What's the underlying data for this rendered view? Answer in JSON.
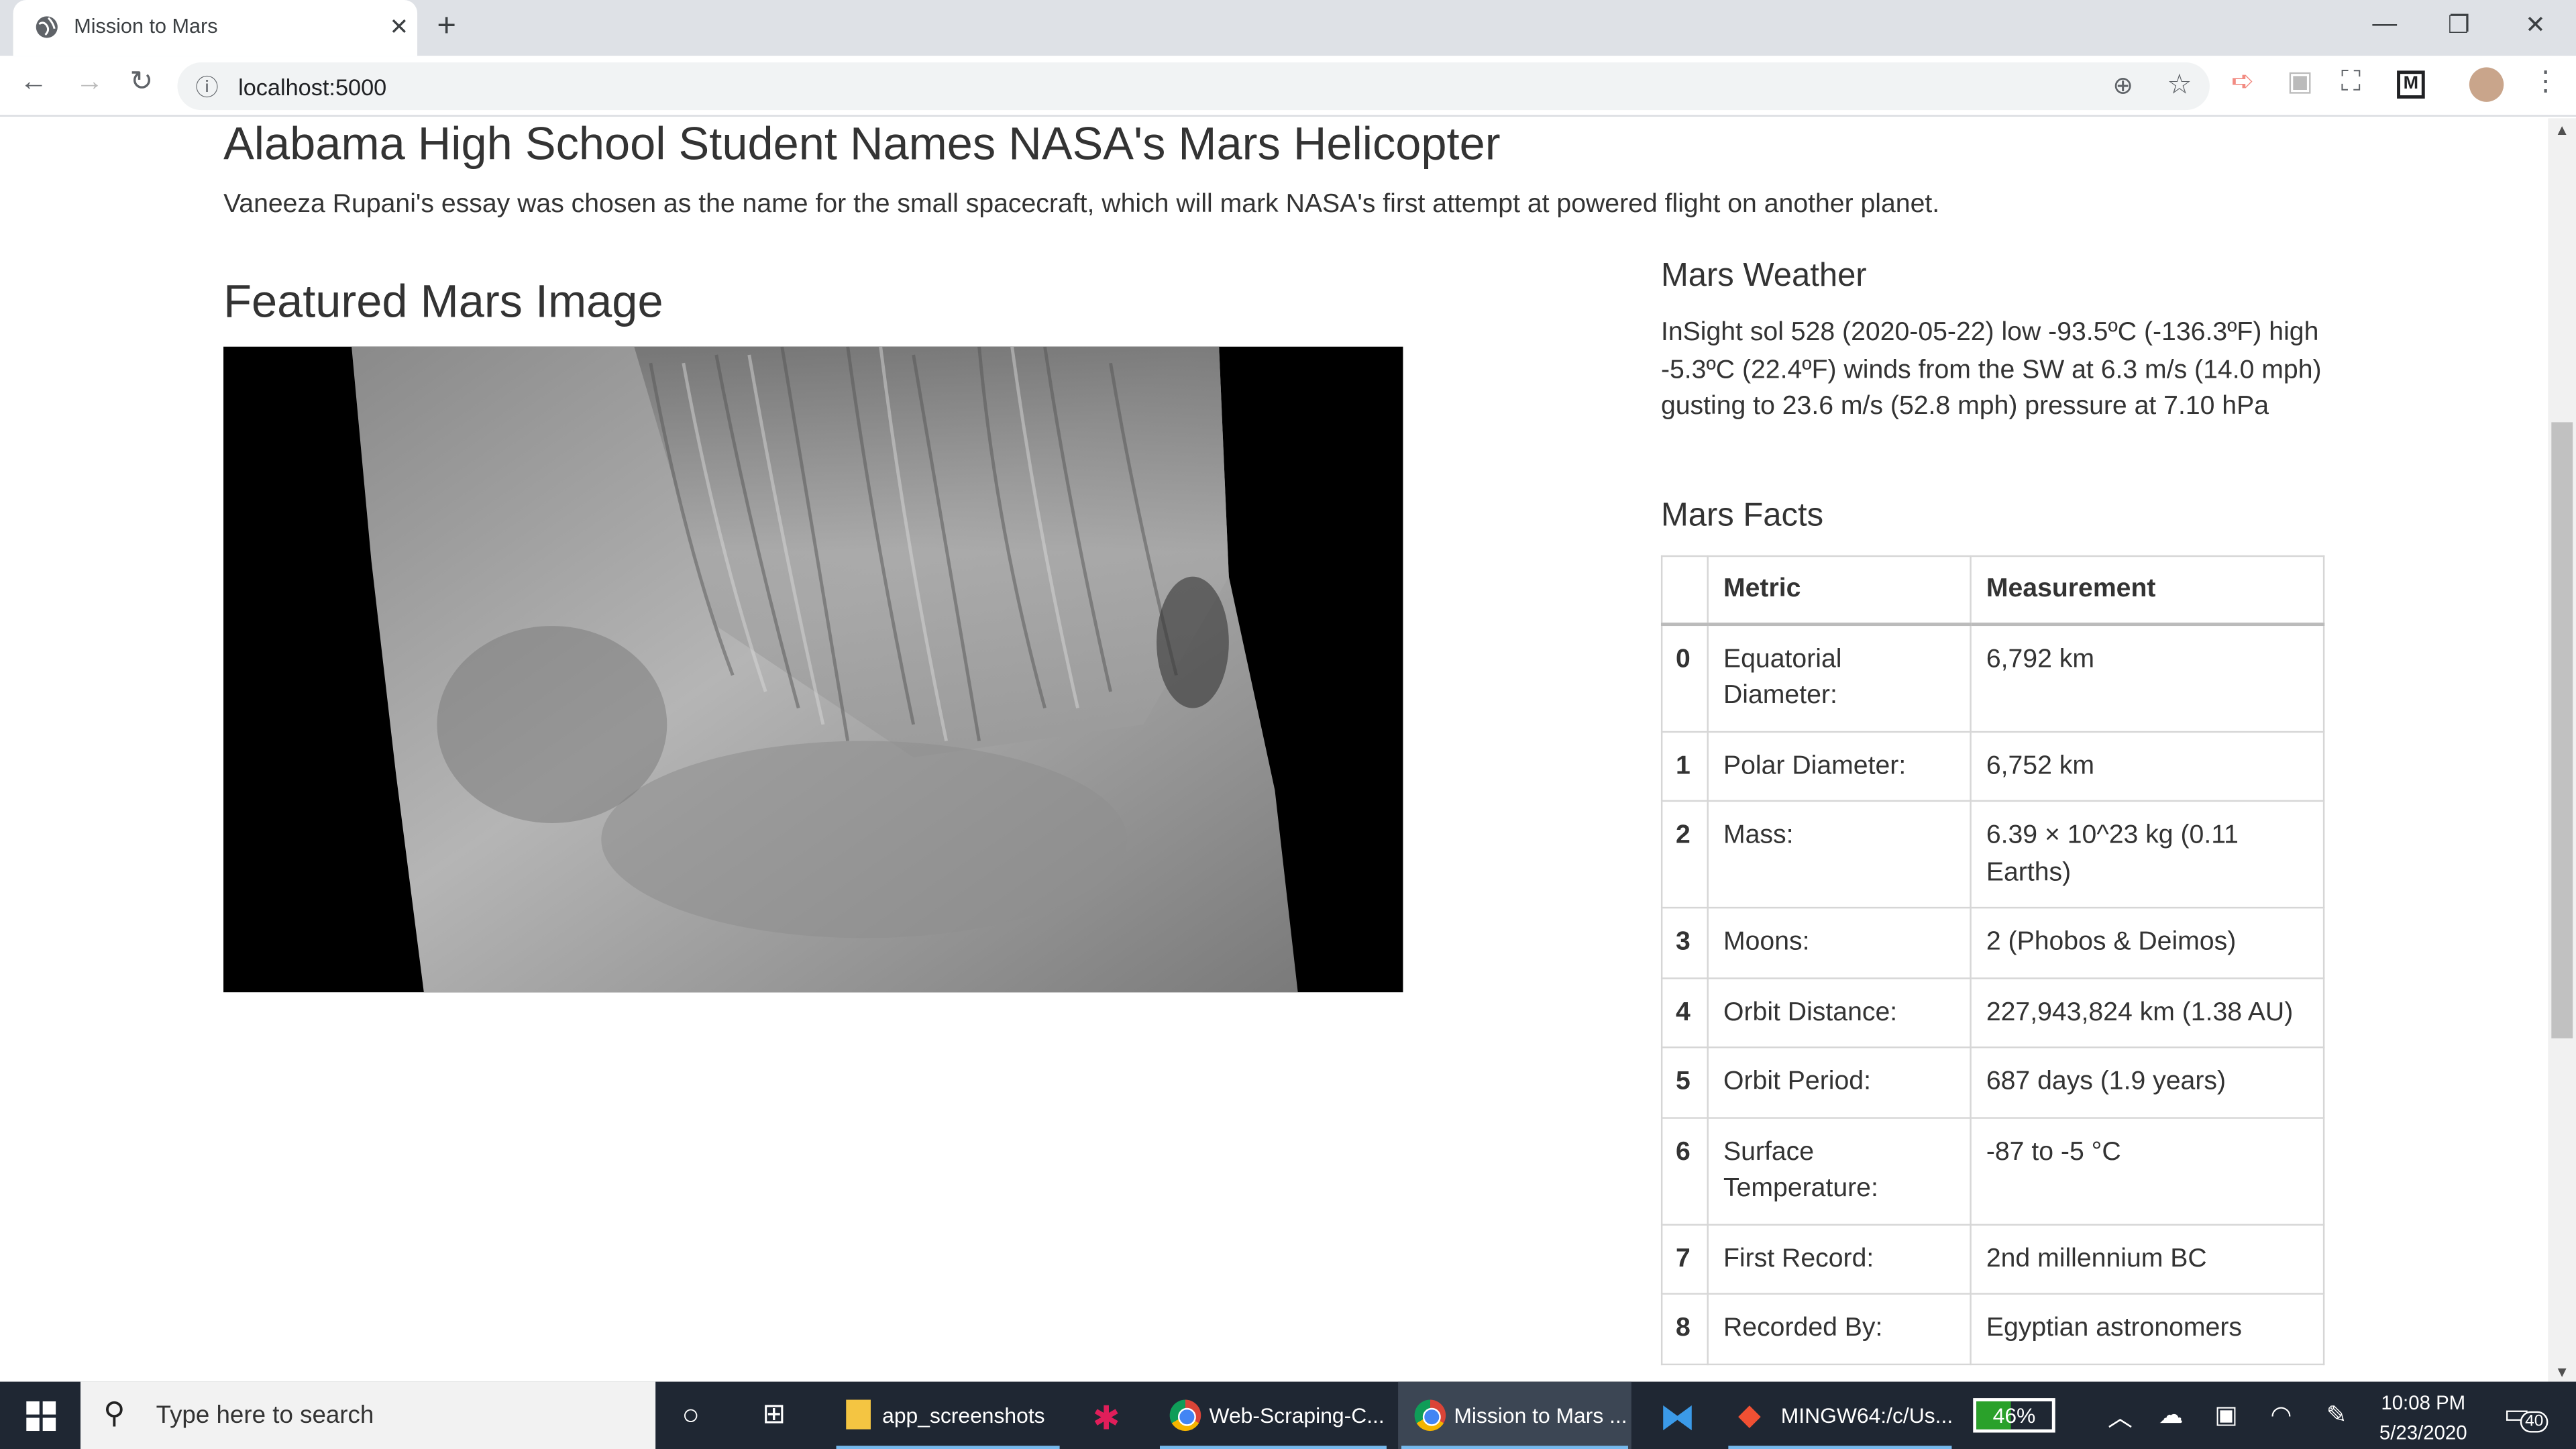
{
  "browser": {
    "tab_title": "Mission to Mars",
    "tab_close": "✕",
    "new_tab": "+",
    "url": "localhost:5000"
  },
  "news": {
    "title": "Alabama High School Student Names NASA's Mars Helicopter",
    "paragraph": "Vaneeza Rupani's essay was chosen as the name for the small spacecraft, which will mark NASA's first attempt at powered flight on another planet."
  },
  "featured": {
    "heading": "Featured Mars Image"
  },
  "weather": {
    "heading": "Mars Weather",
    "text": "InSight sol 528 (2020-05-22) low -93.5ºC (-136.3ºF) high -5.3ºC (22.4ºF) winds from the SW at 6.3 m/s (14.0 mph) gusting to 23.6 m/s (52.8 mph) pressure at 7.10 hPa"
  },
  "facts": {
    "heading": "Mars Facts",
    "headers": [
      "",
      "Metric",
      "Measurement"
    ],
    "rows": [
      {
        "idx": "0",
        "metric": "Equatorial Diameter:",
        "value": "6,792 km"
      },
      {
        "idx": "1",
        "metric": "Polar Diameter:",
        "value": "6,752 km"
      },
      {
        "idx": "2",
        "metric": "Mass:",
        "value": "6.39 × 10^23 kg (0.11 Earths)"
      },
      {
        "idx": "3",
        "metric": "Moons:",
        "value": "2 (Phobos & Deimos)"
      },
      {
        "idx": "4",
        "metric": "Orbit Distance:",
        "value": "227,943,824 km (1.38 AU)"
      },
      {
        "idx": "5",
        "metric": "Orbit Period:",
        "value": "687 days (1.9 years)"
      },
      {
        "idx": "6",
        "metric": "Surface Temperature:",
        "value": "-87 to -5 °C"
      },
      {
        "idx": "7",
        "metric": "First Record:",
        "value": "2nd millennium BC"
      },
      {
        "idx": "8",
        "metric": "Recorded By:",
        "value": "Egyptian astronomers"
      }
    ]
  },
  "taskbar": {
    "search_placeholder": "Type here to search",
    "items": [
      {
        "label": "app_screenshots"
      },
      {
        "label": "Web-Scraping-C..."
      },
      {
        "label": "Mission to Mars ..."
      },
      {
        "label": "MINGW64:/c/Us..."
      }
    ],
    "battery_label": "46%",
    "battery_level": 0.46,
    "time": "10:08 PM",
    "date": "5/23/2020",
    "notification_count": "40"
  },
  "colors": {
    "accent": "#76b9ed",
    "taskbar": "#1f2733",
    "battery": "#2aa12a"
  }
}
